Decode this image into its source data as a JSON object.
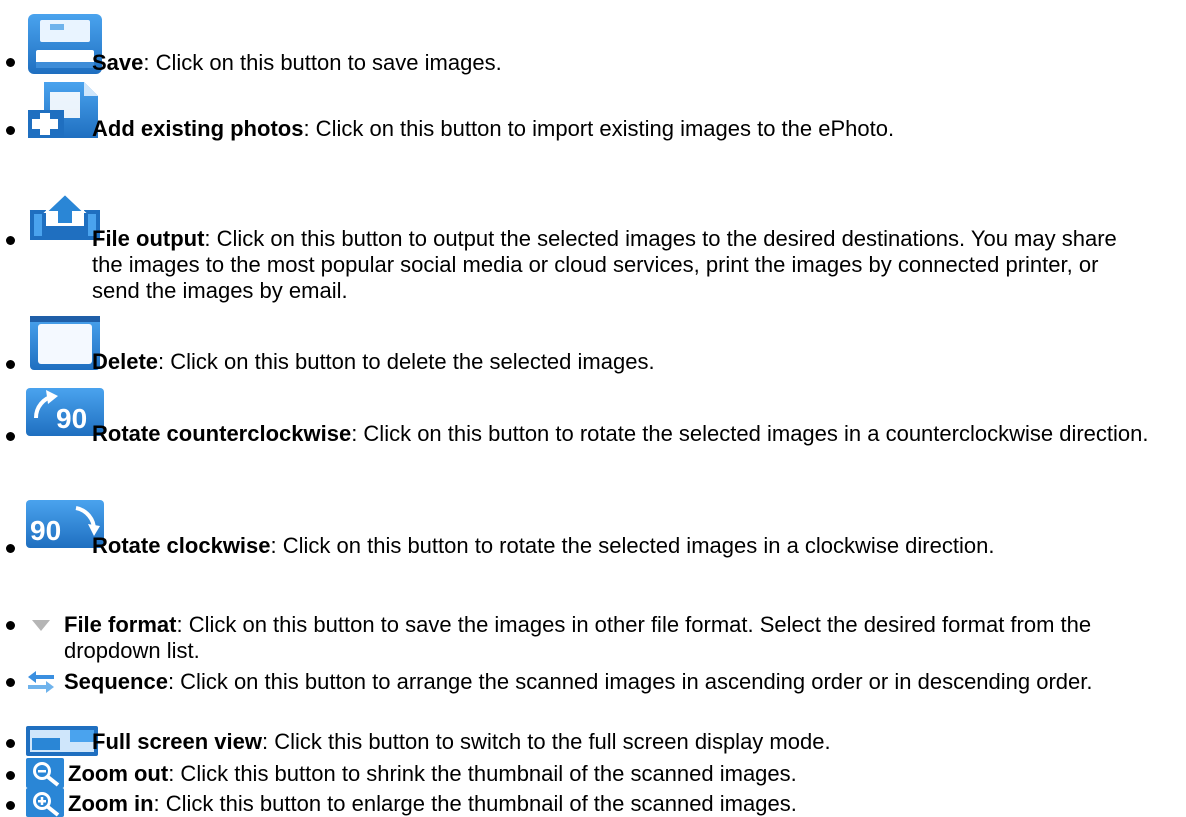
{
  "items": [
    {
      "icon": "save-icon",
      "name": "Save",
      "desc": ": Click on this button to save images."
    },
    {
      "icon": "add-photos-icon",
      "name": "Add existing photos",
      "desc": ": Click on this button to import existing images to the ePhoto."
    },
    {
      "icon": "file-output-icon",
      "name": "File output",
      "desc": ": Click on this button to output the selected images to the desired destinations. You may share the images to the most popular social media or cloud services, print the images by connected printer, or send the images by email."
    },
    {
      "icon": "delete-icon",
      "name": "Delete",
      "desc": ": Click on this button to delete the selected images."
    },
    {
      "icon": "rotate-counterclockwise-icon",
      "name": "Rotate counterclockwise",
      "desc": ": Click on this button to rotate the selected images in a counterclockwise direction."
    },
    {
      "icon": "rotate-clockwise-icon",
      "name": "Rotate clockwise",
      "desc": ": Click on this button to rotate the selected images in a clockwise direction."
    },
    {
      "icon": "dropdown-arrow-icon",
      "name": "File format",
      "desc": ": Click on this button to save the images in other file format. Select the desired format from the dropdown list."
    },
    {
      "icon": "sequence-arrows-icon",
      "name": "Sequence",
      "desc": ": Click on this button to arrange the scanned images in ascending order or in descending order."
    },
    {
      "icon": "full-screen-icon",
      "name": "Full screen view",
      "desc": ": Click this button to switch to the full screen display mode."
    },
    {
      "icon": "zoom-out-icon",
      "name": "Zoom out",
      "desc": ": Click this button to shrink the thumbnail of the scanned images."
    },
    {
      "icon": "zoom-in-icon",
      "name": "Zoom in",
      "desc": ": Click this button to enlarge the thumbnail of the scanned images."
    }
  ],
  "icon_text": {
    "rotate_ccw": "90",
    "rotate_cw": "90"
  },
  "colors": {
    "icon_blue": "#2a86d6",
    "icon_dark": "#1f5fa8",
    "icon_light": "#cfe6fb",
    "arrow_gray": "#b5b5b5"
  }
}
